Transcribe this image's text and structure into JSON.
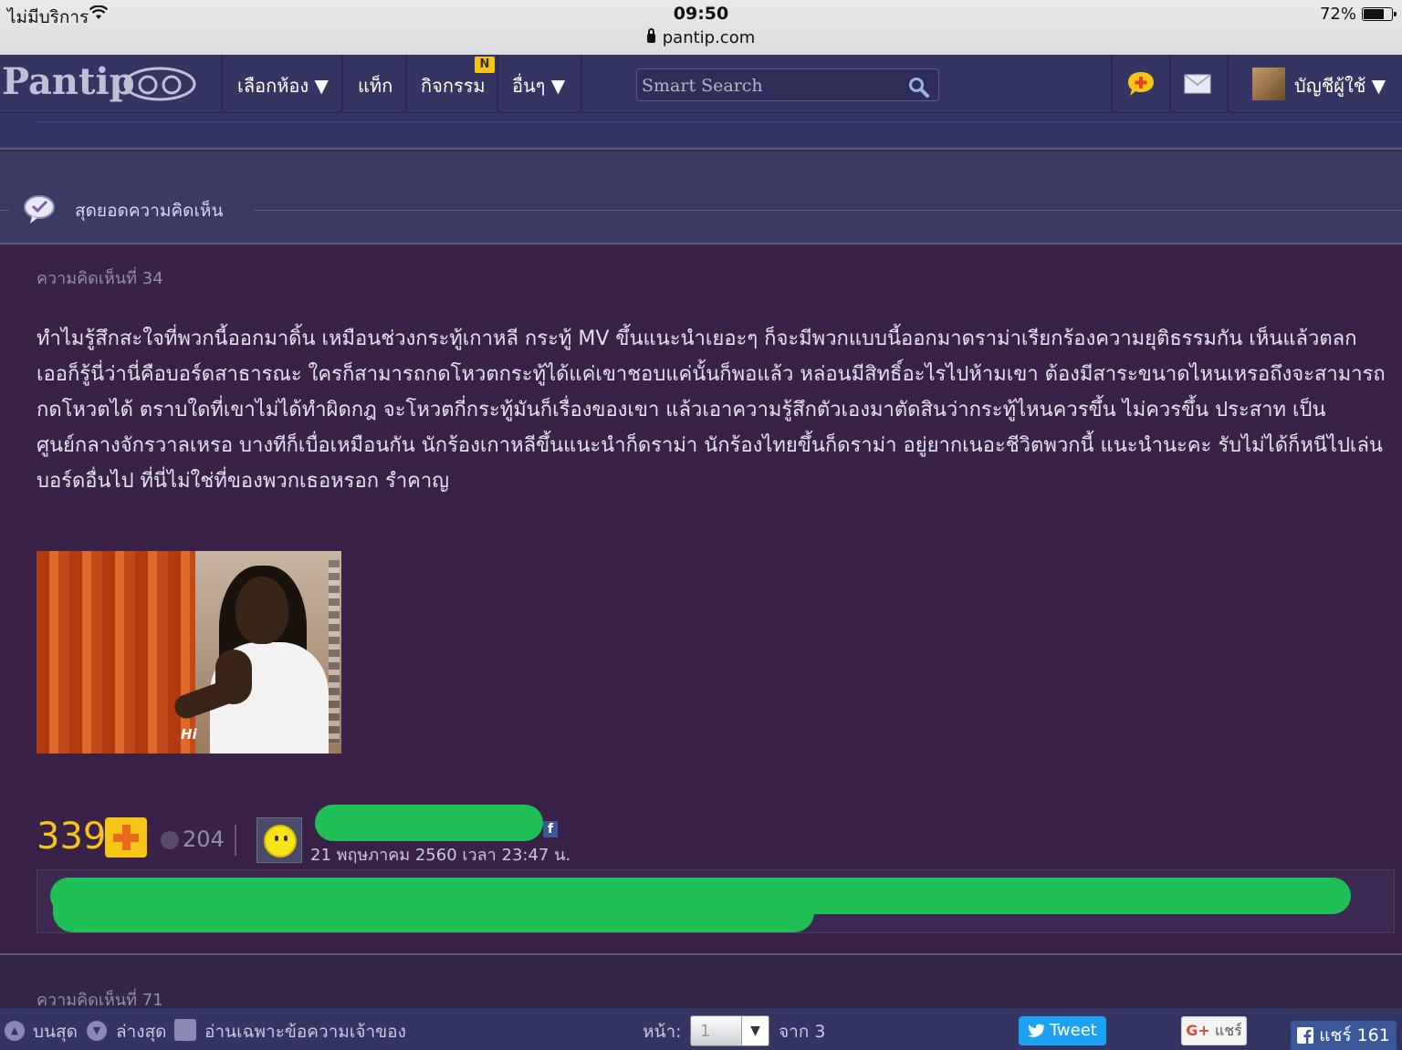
{
  "status_bar": {
    "carrier": "ไม่มีบริการ",
    "time": "09:50",
    "url": "pantip.com",
    "battery": "72%",
    "battery_level": 0.72
  },
  "nav": {
    "logo": "Pantip",
    "menu": [
      "เลือกห้อง ▼",
      "แท็ก",
      "กิจกรรม",
      "อื่นๆ ▼"
    ],
    "new_badge": "N",
    "search_placeholder": "Smart Search",
    "account_label": "บัญชีผู้ใช้ ▼"
  },
  "section": {
    "title": "สุดยอดความคิดเห็น"
  },
  "comment": {
    "number_label": "ความคิดเห็นที่ 34",
    "body": "ทำไมรู้สึกสะใจที่พวกนี้ออกมาดิ้น เหมือนช่วงกระทู้เกาหลี กระทู้ MV ขึ้นแนะนำเยอะๆ ก็จะมีพวกแบบนี้ออกมาดราม่าเรียกร้องความยุติธรรมกัน เห็นแล้วตลก เออก็รู้นี่ว่านี่คือบอร์ดสาธารณะ ใครก็สามารถกดโหวตกระทู้ได้แค่เขาชอบแค่นั้นก็พอแล้ว หล่อนมีสิทธิ์อะไรไปห้ามเขา ต้องมีสาระขนาดไหนเหรอถึงจะสามารถกดโหวตได้ ตราบใดที่เขาไม่ได้ทำผิดกฎ จะโหวตกี่กระทู้มันก็เรื่องของเขา แล้วเอาความรู้สึกตัวเองมาตัดสินว่ากระทู้ไหนควรขึ้น ไม่ควรขึ้น ประสาท เป็นศูนย์กลางจักรวาลเหรอ บางทีก็เบื่อเหมือนกัน นักร้องเกาหลีขึ้นแนะนำก็ดราม่า นักร้องไทยขึ้นก็ดราม่า อยู่ยากเนอะชีวิตพวกนี้ แนะนำนะคะ รับไม่ได้ก็หนีไปเล่นบอร์ดอื่นไป ที่นี่ไม่ใช่ที่ของพวกเธอหรอก รำคาญ",
    "gif_caption": "Hi",
    "score": "339",
    "emotion_count": "204",
    "fb_mark": "f",
    "timestamp": "21 พฤษภาคม 2560 เวลา 23:47 น."
  },
  "next_comment": {
    "number_label": "ความคิดเห็นที่ 71"
  },
  "bottom_bar": {
    "top_label": "บนสุด",
    "bottom_label": "ล่างสุด",
    "owner_only_label": "อ่านเฉพาะข้อความเจ้าของ",
    "page_label": "หน้า:",
    "page_value": "1",
    "page_total_label": "จาก 3",
    "tweet_label": "Tweet",
    "gplus_label": "แชร์",
    "fb_share_label": "แชร์ 161"
  }
}
